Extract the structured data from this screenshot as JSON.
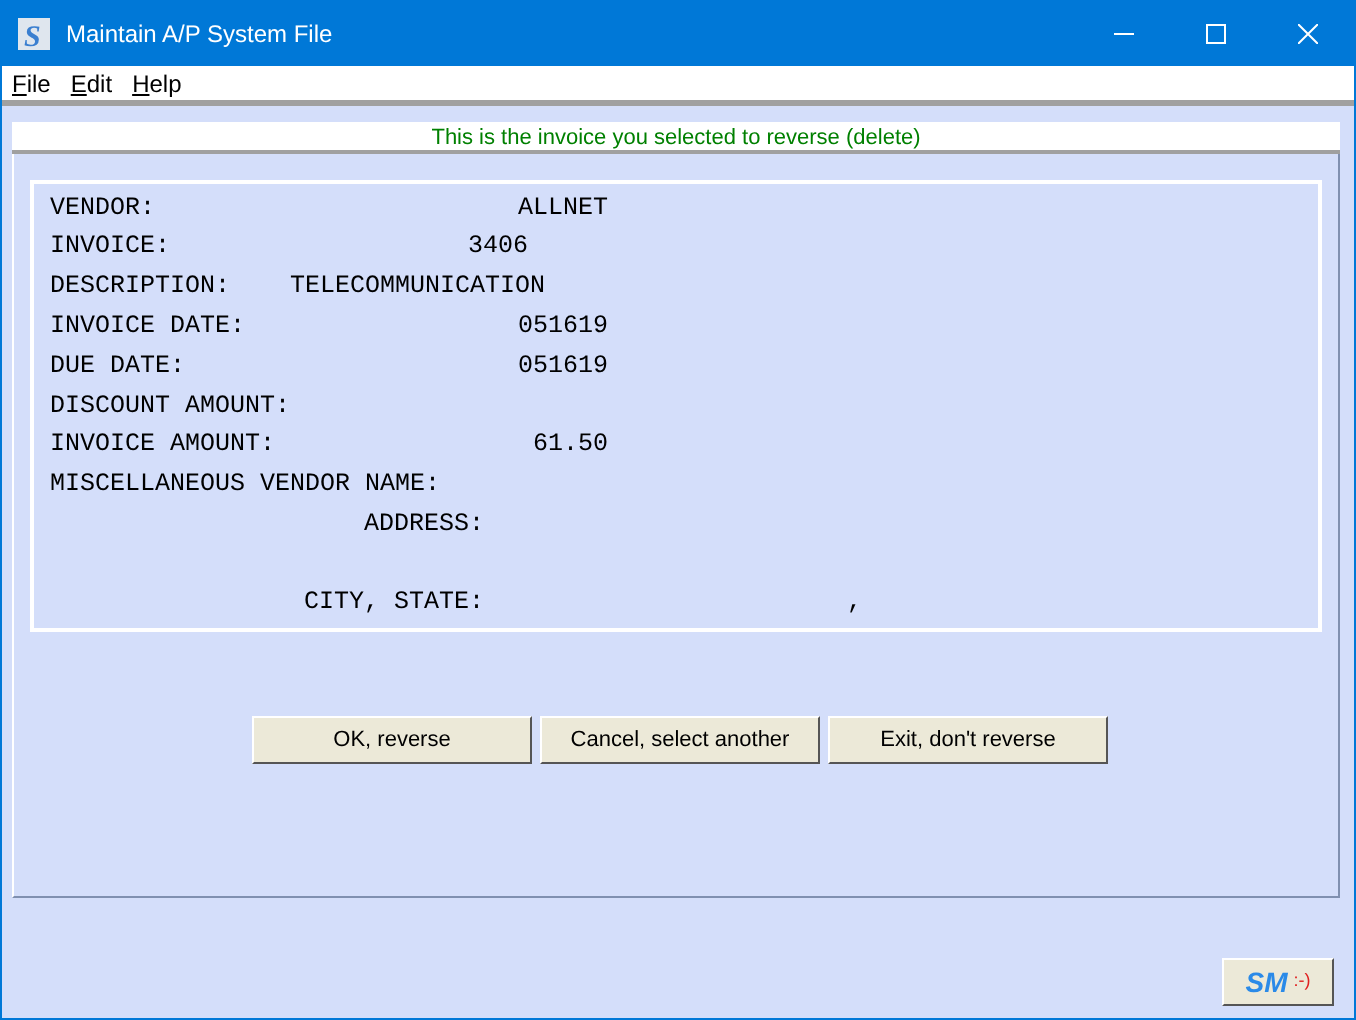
{
  "window": {
    "title": "Maintain A/P System File",
    "app_icon": "S"
  },
  "menu": [
    {
      "label": "File",
      "mnemonic": true
    },
    {
      "label": "Edit",
      "mnemonic": true
    },
    {
      "label": "Help",
      "mnemonic": true
    }
  ],
  "message": "This is the invoice you selected to reverse (delete)",
  "fields": [
    {
      "kind": "amount",
      "label": "VENDOR:",
      "value": "ALLNET"
    },
    {
      "kind": "number",
      "label": "INVOICE:",
      "value": "3406"
    },
    {
      "kind": "text",
      "label": "DESCRIPTION:",
      "value": "TELECOMMUNICATION"
    },
    {
      "kind": "amount",
      "label": "INVOICE DATE:",
      "value": "051619"
    },
    {
      "kind": "amount",
      "label": "DUE DATE:",
      "value": "051619"
    },
    {
      "kind": "label",
      "label": "DISCOUNT AMOUNT:"
    },
    {
      "kind": "amount",
      "label": "INVOICE AMOUNT:",
      "value": "61.50"
    },
    {
      "kind": "label",
      "label": "MISCELLANEOUS VENDOR NAME:"
    },
    {
      "kind": "sub",
      "label": "ADDRESS:"
    },
    {
      "kind": "city",
      "label": "CITY, STATE:",
      "value": ","
    }
  ],
  "buttons": [
    "OK, reverse",
    "Cancel, select another",
    "Exit, don't reverse"
  ],
  "logo_button": {
    "text": "SM",
    "smiley": ":-)"
  }
}
